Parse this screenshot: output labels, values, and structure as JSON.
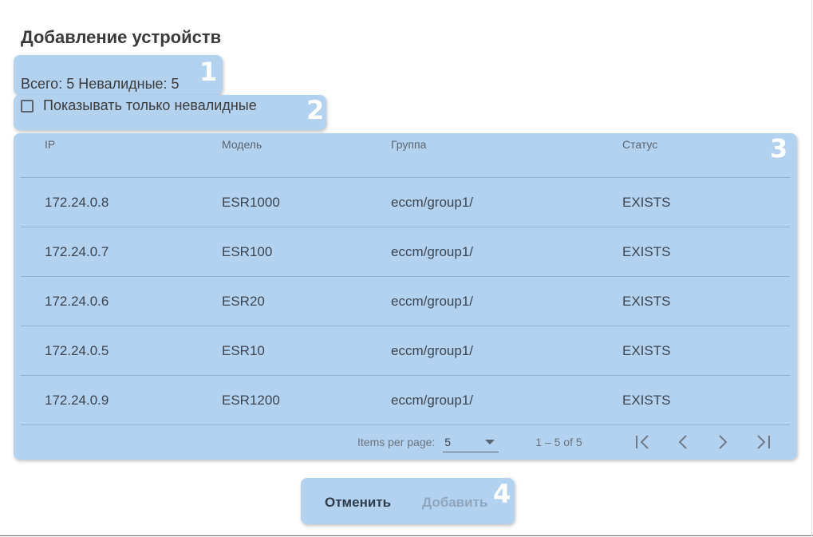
{
  "dialog": {
    "title": "Добавление устройств"
  },
  "summary": {
    "text": "Всего: 5 Невалидные: 5"
  },
  "filter": {
    "checkbox_label": "Показывать только невалидные",
    "checked": false
  },
  "table": {
    "columns": [
      "IP",
      "Модель",
      "Группа",
      "Статус"
    ],
    "rows": [
      [
        "172.24.0.8",
        "ESR1000",
        "eccm/group1/",
        "EXISTS"
      ],
      [
        "172.24.0.7",
        "ESR100",
        "eccm/group1/",
        "EXISTS"
      ],
      [
        "172.24.0.6",
        "ESR20",
        "eccm/group1/",
        "EXISTS"
      ],
      [
        "172.24.0.5",
        "ESR10",
        "eccm/group1/",
        "EXISTS"
      ],
      [
        "172.24.0.9",
        "ESR1200",
        "eccm/group1/",
        "EXISTS"
      ]
    ]
  },
  "paginator": {
    "items_per_page_label": "Items per page:",
    "page_size": "5",
    "range_label": "1 – 5 of 5"
  },
  "actions": {
    "cancel_label": "Отменить",
    "add_label": "Добавить"
  },
  "annotations": [
    "1",
    "2",
    "3",
    "4"
  ],
  "colors": {
    "highlight": "#b3d2f0",
    "annotation_text": "#ffffff"
  }
}
